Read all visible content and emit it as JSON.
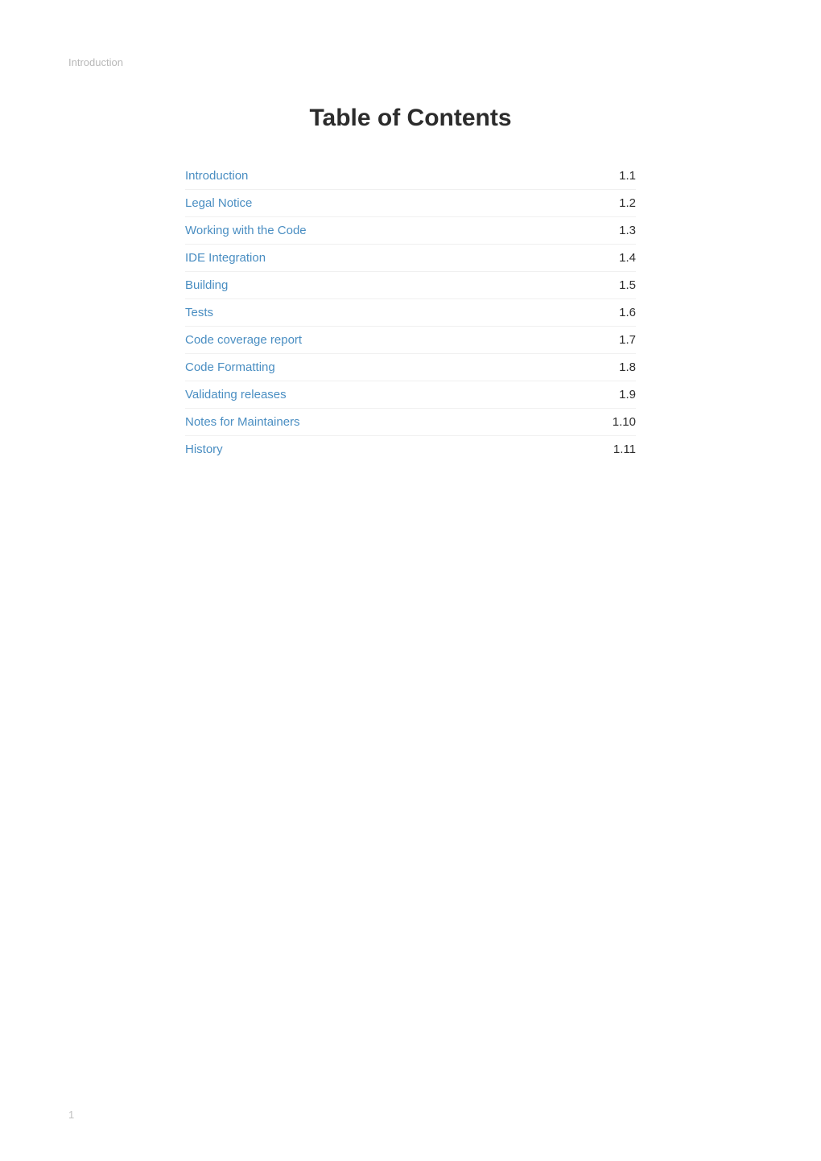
{
  "breadcrumb": "Introduction",
  "title": "Table of Contents",
  "toc": [
    {
      "label": "Introduction",
      "number": "1.1"
    },
    {
      "label": "Legal Notice",
      "number": "1.2"
    },
    {
      "label": "Working with the Code",
      "number": "1.3"
    },
    {
      "label": "IDE Integration",
      "number": "1.4"
    },
    {
      "label": "Building",
      "number": "1.5"
    },
    {
      "label": "Tests",
      "number": "1.6"
    },
    {
      "label": "Code coverage report",
      "number": "1.7"
    },
    {
      "label": "Code Formatting",
      "number": "1.8"
    },
    {
      "label": "Validating releases",
      "number": "1.9"
    },
    {
      "label": "Notes for Maintainers",
      "number": "1.10"
    },
    {
      "label": "History",
      "number": "1.11"
    }
  ],
  "page_number": "1"
}
